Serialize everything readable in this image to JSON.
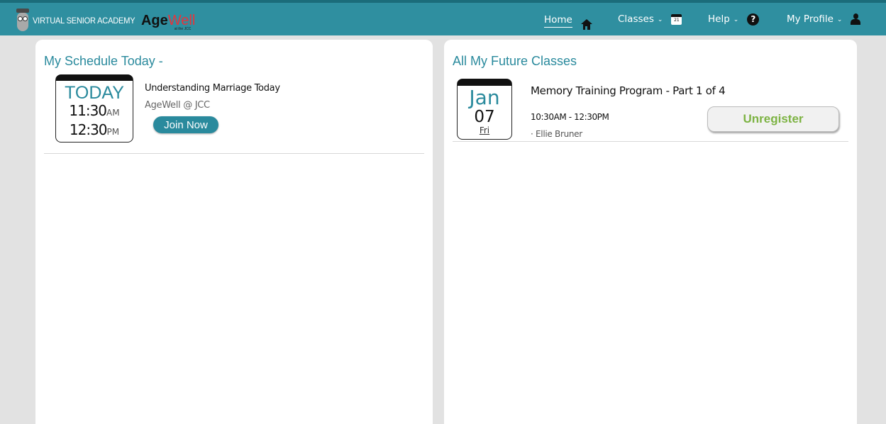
{
  "header": {
    "brand_text": "VIRTUAL SENIOR ACADEMY",
    "logo_age": "Age",
    "logo_well": "Well",
    "logo_sub": "at the JCC",
    "nav": {
      "home": "Home",
      "classes": "Classes",
      "help": "Help",
      "profile": "My Profile",
      "chevron": "⌄",
      "calendar_day": "21",
      "help_glyph": "?"
    },
    "icons": [
      "owl-logo-icon",
      "home-icon",
      "calendar-icon",
      "help-icon",
      "user-icon"
    ]
  },
  "schedule_today": {
    "title": "My Schedule Today -",
    "card": {
      "label": "TODAY",
      "start_time": "11:30",
      "start_ampm": "AM",
      "end_time": "12:30",
      "end_ampm": "PM"
    },
    "class_title": "Understanding Marriage Today",
    "location": "AgeWell @ JCC",
    "join_label": "Join Now"
  },
  "future_classes": {
    "title": "All My Future Classes",
    "items": [
      {
        "month": "Jan",
        "day": "07",
        "weekday": "Fri",
        "title": "Memory Training Program - Part 1 of 4",
        "time": "10:30AM - 12:30PM",
        "instructor": "· Ellie Bruner",
        "action_label": "Unregister"
      }
    ]
  },
  "colors": {
    "header_bg": "#2f8fa0",
    "accent_teal": "#2a8a9d",
    "unregister_green": "#7db343",
    "page_bg": "#e2e2e2"
  }
}
